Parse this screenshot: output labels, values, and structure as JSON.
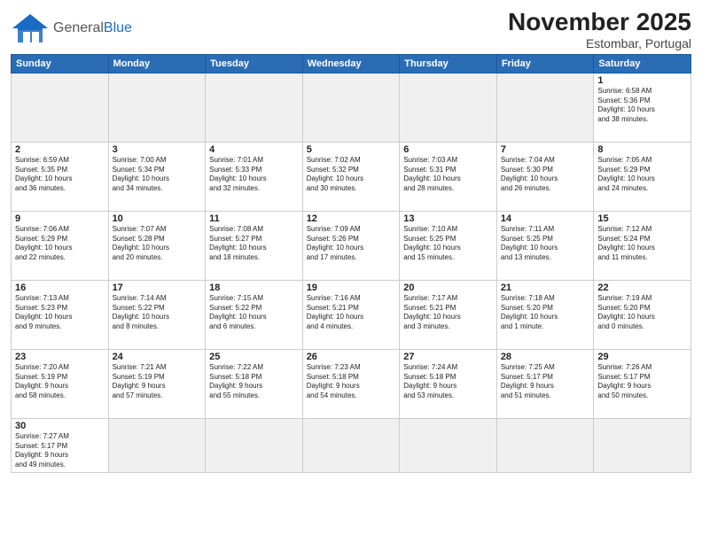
{
  "header": {
    "logo_general": "General",
    "logo_blue": "Blue",
    "month_title": "November 2025",
    "location": "Estombar, Portugal"
  },
  "days_of_week": [
    "Sunday",
    "Monday",
    "Tuesday",
    "Wednesday",
    "Thursday",
    "Friday",
    "Saturday"
  ],
  "weeks": [
    [
      {
        "day": "",
        "info": ""
      },
      {
        "day": "",
        "info": ""
      },
      {
        "day": "",
        "info": ""
      },
      {
        "day": "",
        "info": ""
      },
      {
        "day": "",
        "info": ""
      },
      {
        "day": "",
        "info": ""
      },
      {
        "day": "1",
        "info": "Sunrise: 6:58 AM\nSunset: 5:36 PM\nDaylight: 10 hours\nand 38 minutes."
      }
    ],
    [
      {
        "day": "2",
        "info": "Sunrise: 6:59 AM\nSunset: 5:35 PM\nDaylight: 10 hours\nand 36 minutes."
      },
      {
        "day": "3",
        "info": "Sunrise: 7:00 AM\nSunset: 5:34 PM\nDaylight: 10 hours\nand 34 minutes."
      },
      {
        "day": "4",
        "info": "Sunrise: 7:01 AM\nSunset: 5:33 PM\nDaylight: 10 hours\nand 32 minutes."
      },
      {
        "day": "5",
        "info": "Sunrise: 7:02 AM\nSunset: 5:32 PM\nDaylight: 10 hours\nand 30 minutes."
      },
      {
        "day": "6",
        "info": "Sunrise: 7:03 AM\nSunset: 5:31 PM\nDaylight: 10 hours\nand 28 minutes."
      },
      {
        "day": "7",
        "info": "Sunrise: 7:04 AM\nSunset: 5:30 PM\nDaylight: 10 hours\nand 26 minutes."
      },
      {
        "day": "8",
        "info": "Sunrise: 7:05 AM\nSunset: 5:29 PM\nDaylight: 10 hours\nand 24 minutes."
      }
    ],
    [
      {
        "day": "9",
        "info": "Sunrise: 7:06 AM\nSunset: 5:29 PM\nDaylight: 10 hours\nand 22 minutes."
      },
      {
        "day": "10",
        "info": "Sunrise: 7:07 AM\nSunset: 5:28 PM\nDaylight: 10 hours\nand 20 minutes."
      },
      {
        "day": "11",
        "info": "Sunrise: 7:08 AM\nSunset: 5:27 PM\nDaylight: 10 hours\nand 18 minutes."
      },
      {
        "day": "12",
        "info": "Sunrise: 7:09 AM\nSunset: 5:26 PM\nDaylight: 10 hours\nand 17 minutes."
      },
      {
        "day": "13",
        "info": "Sunrise: 7:10 AM\nSunset: 5:25 PM\nDaylight: 10 hours\nand 15 minutes."
      },
      {
        "day": "14",
        "info": "Sunrise: 7:11 AM\nSunset: 5:25 PM\nDaylight: 10 hours\nand 13 minutes."
      },
      {
        "day": "15",
        "info": "Sunrise: 7:12 AM\nSunset: 5:24 PM\nDaylight: 10 hours\nand 11 minutes."
      }
    ],
    [
      {
        "day": "16",
        "info": "Sunrise: 7:13 AM\nSunset: 5:23 PM\nDaylight: 10 hours\nand 9 minutes."
      },
      {
        "day": "17",
        "info": "Sunrise: 7:14 AM\nSunset: 5:22 PM\nDaylight: 10 hours\nand 8 minutes."
      },
      {
        "day": "18",
        "info": "Sunrise: 7:15 AM\nSunset: 5:22 PM\nDaylight: 10 hours\nand 6 minutes."
      },
      {
        "day": "19",
        "info": "Sunrise: 7:16 AM\nSunset: 5:21 PM\nDaylight: 10 hours\nand 4 minutes."
      },
      {
        "day": "20",
        "info": "Sunrise: 7:17 AM\nSunset: 5:21 PM\nDaylight: 10 hours\nand 3 minutes."
      },
      {
        "day": "21",
        "info": "Sunrise: 7:18 AM\nSunset: 5:20 PM\nDaylight: 10 hours\nand 1 minute."
      },
      {
        "day": "22",
        "info": "Sunrise: 7:19 AM\nSunset: 5:20 PM\nDaylight: 10 hours\nand 0 minutes."
      }
    ],
    [
      {
        "day": "23",
        "info": "Sunrise: 7:20 AM\nSunset: 5:19 PM\nDaylight: 9 hours\nand 58 minutes."
      },
      {
        "day": "24",
        "info": "Sunrise: 7:21 AM\nSunset: 5:19 PM\nDaylight: 9 hours\nand 57 minutes."
      },
      {
        "day": "25",
        "info": "Sunrise: 7:22 AM\nSunset: 5:18 PM\nDaylight: 9 hours\nand 55 minutes."
      },
      {
        "day": "26",
        "info": "Sunrise: 7:23 AM\nSunset: 5:18 PM\nDaylight: 9 hours\nand 54 minutes."
      },
      {
        "day": "27",
        "info": "Sunrise: 7:24 AM\nSunset: 5:18 PM\nDaylight: 9 hours\nand 53 minutes."
      },
      {
        "day": "28",
        "info": "Sunrise: 7:25 AM\nSunset: 5:17 PM\nDaylight: 9 hours\nand 51 minutes."
      },
      {
        "day": "29",
        "info": "Sunrise: 7:26 AM\nSunset: 5:17 PM\nDaylight: 9 hours\nand 50 minutes."
      }
    ],
    [
      {
        "day": "30",
        "info": "Sunrise: 7:27 AM\nSunset: 5:17 PM\nDaylight: 9 hours\nand 49 minutes."
      },
      {
        "day": "",
        "info": ""
      },
      {
        "day": "",
        "info": ""
      },
      {
        "day": "",
        "info": ""
      },
      {
        "day": "",
        "info": ""
      },
      {
        "day": "",
        "info": ""
      },
      {
        "day": "",
        "info": ""
      }
    ]
  ]
}
